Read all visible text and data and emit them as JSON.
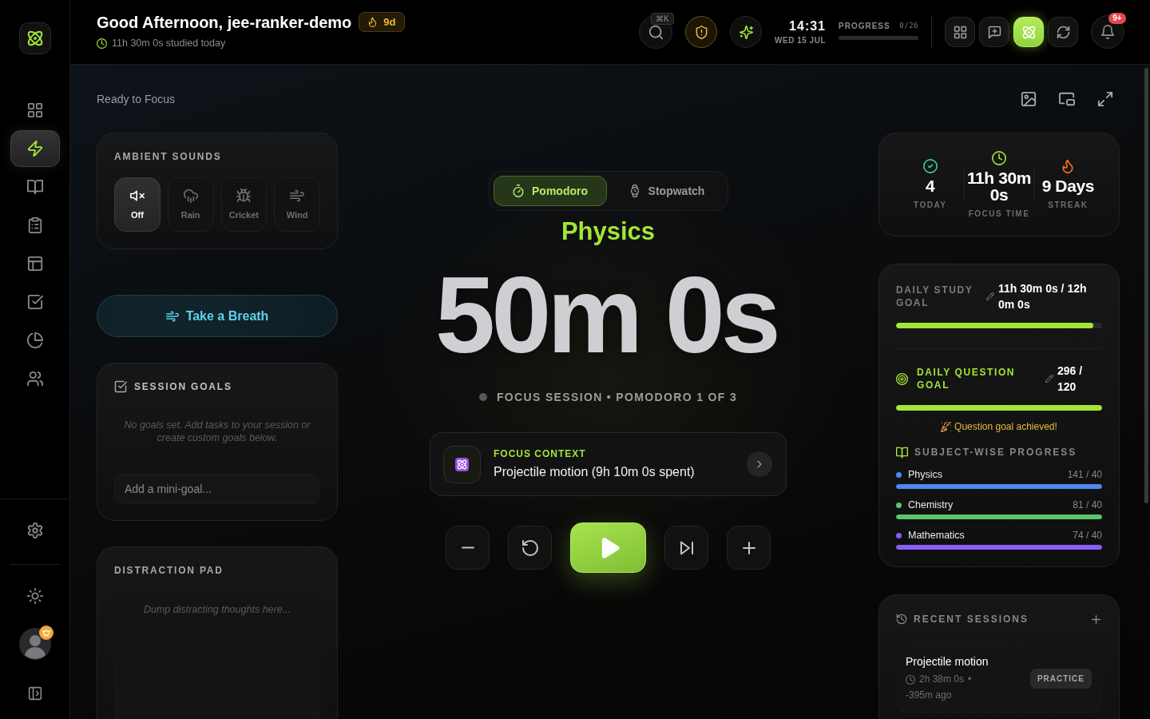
{
  "sidebar": {
    "nav_items": [
      {
        "kind": "grid",
        "selected": false
      },
      {
        "kind": "zap",
        "selected": true
      },
      {
        "kind": "book",
        "selected": false
      },
      {
        "kind": "clipboard",
        "selected": false
      },
      {
        "kind": "layout",
        "selected": false
      },
      {
        "kind": "tasks",
        "selected": false
      },
      {
        "kind": "chart",
        "selected": false
      },
      {
        "kind": "users",
        "selected": false
      }
    ]
  },
  "header": {
    "greeting": "Good Afternoon, jee-ranker-demo",
    "streak": "9d",
    "studied_today": "11h 30m 0s studied today",
    "search_shortcut": "⌘K",
    "time": "14:31",
    "date": "WED 15 JUL",
    "progress": {
      "label": "PROGRESS",
      "count": "0/26",
      "level": 0
    },
    "toolbar": [
      {
        "kind": "grid",
        "selected": false
      },
      {
        "kind": "message",
        "selected": false
      },
      {
        "kind": "atom",
        "selected": true
      },
      {
        "kind": "refresh",
        "selected": false
      }
    ],
    "notifications_badge": "9+"
  },
  "status": "Ready to Focus",
  "ambient_sounds": {
    "title": "AMBIENT SOUNDS",
    "options": [
      {
        "kind": "mute",
        "label": "Off",
        "selected": true
      },
      {
        "kind": "rain",
        "label": "Rain",
        "selected": false
      },
      {
        "kind": "cricket",
        "label": "Cricket",
        "selected": false
      },
      {
        "kind": "wind",
        "label": "Wind",
        "selected": false
      }
    ]
  },
  "breath_button": "Take a Breath",
  "session_goals": {
    "title": "SESSION GOALS",
    "empty_text": "No goals set. Add tasks to your session or create custom goals below.",
    "placeholder": "Add a mini-goal..."
  },
  "distraction_pad": {
    "title": "DISTRACTION PAD",
    "placeholder": "Dump distracting thoughts here..."
  },
  "timer": {
    "modes": [
      {
        "kind": "timer",
        "label": "Pomodoro",
        "selected": true
      },
      {
        "kind": "watch",
        "label": "Stopwatch",
        "selected": false
      }
    ],
    "subject": "Physics",
    "time": "50m 0s",
    "session": "FOCUS SESSION • POMODORO 1 OF 3",
    "context": {
      "label": "FOCUS CONTEXT",
      "text": "Projectile motion (9h 10m 0s spent)"
    },
    "controls": [
      {
        "kind": "minus"
      },
      {
        "kind": "reset"
      },
      {
        "kind": "play"
      },
      {
        "kind": "skip"
      },
      {
        "kind": "plus"
      }
    ]
  },
  "stats": [
    {
      "kind": "check",
      "value": "4",
      "label": "TODAY"
    },
    {
      "kind": "clock",
      "value": "11h 30m 0s",
      "label": "FOCUS TIME"
    },
    {
      "kind": "flame",
      "value": "9 Days",
      "label": "STREAK"
    }
  ],
  "goals": {
    "study": {
      "title": "DAILY STUDY GOAL",
      "value": "11h 30m 0s / 12h 0m 0s",
      "level": 0.958
    },
    "questions": {
      "title": "DAILY QUESTION GOAL",
      "value": "296 / 120",
      "level": 1,
      "message": "Question goal achieved!"
    },
    "subjects_title": "SUBJECT-WISE PROGRESS",
    "subjects": [
      {
        "name": "Physics",
        "count": "141 / 40",
        "color": "#4f86f0",
        "level": 1
      },
      {
        "name": "Chemistry",
        "count": "81 / 40",
        "color": "#5cc46a",
        "level": 1
      },
      {
        "name": "Mathematics",
        "count": "74 / 40",
        "color": "#8b5cf6",
        "level": 1
      }
    ]
  },
  "recent_sessions": {
    "title": "RECENT SESSIONS",
    "items": [
      {
        "title": "Projectile motion",
        "duration": "2h 38m 0s",
        "separator": "•",
        "ago": "-395m ago",
        "tag": "PRACTICE"
      }
    ]
  }
}
